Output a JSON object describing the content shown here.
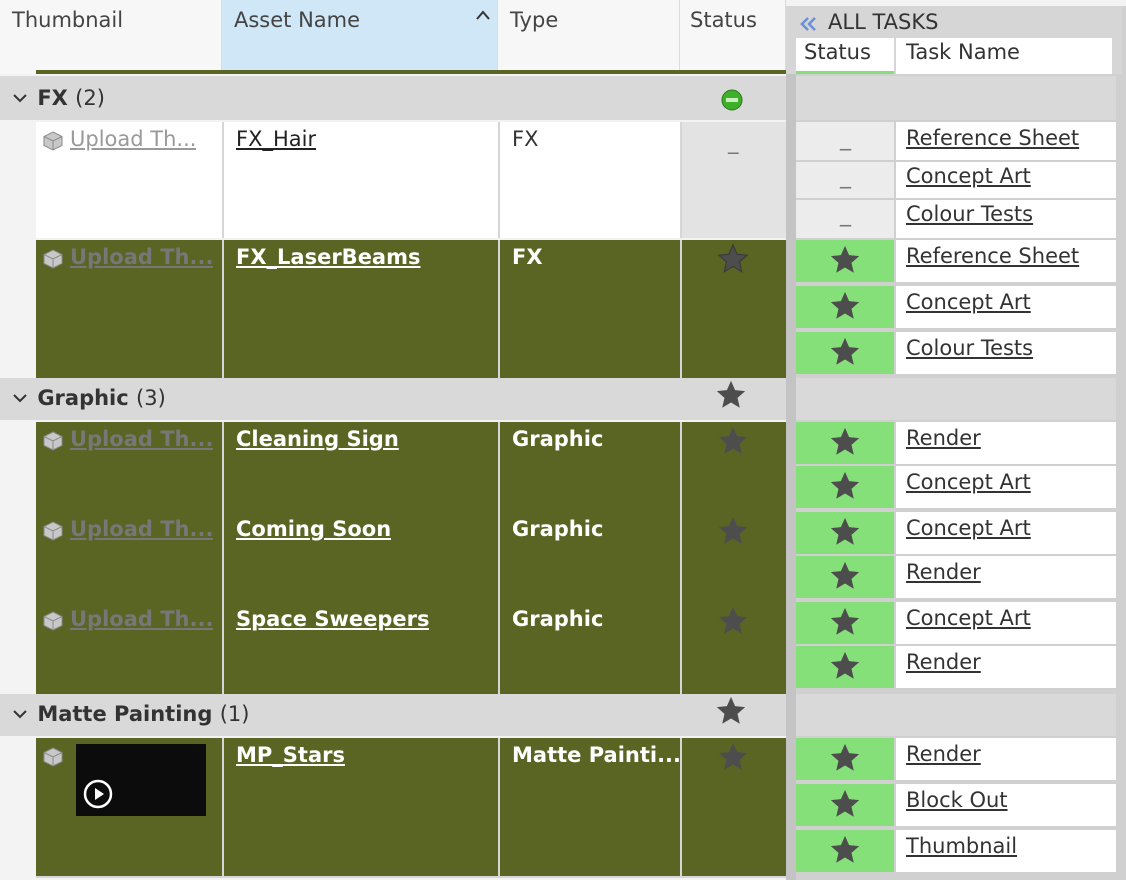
{
  "header": {
    "thumbnail": "Thumbnail",
    "asset_name": "Asset Name",
    "sort_arrow": "^",
    "type": "Type",
    "status": "Status",
    "all_tasks": "ALL TASKS",
    "collapse_icon": "double-chevron-left-icon",
    "task_status": "Status",
    "task_name": "Task Name"
  },
  "groups": [
    {
      "name": "FX",
      "count": "(2)",
      "status": "in-progress-dot"
    },
    {
      "name": "Graphic",
      "count": "(3)",
      "status": "star"
    },
    {
      "name": "Matte Painting",
      "count": "(1)",
      "status": "star"
    }
  ],
  "assets": [
    {
      "thumbnail": "Upload Th...",
      "name": "FX_Hair",
      "type": "FX",
      "status": "_",
      "tasks": [
        {
          "status": "_",
          "name": "Reference Sheet"
        },
        {
          "status": "_",
          "name": "Concept Art"
        },
        {
          "status": "_",
          "name": "Colour Tests"
        }
      ]
    },
    {
      "thumbnail": "Upload Th...",
      "name": "FX_LaserBeams",
      "type": "FX",
      "status": "star",
      "tasks": [
        {
          "status": "star",
          "name": "Reference Sheet"
        },
        {
          "status": "star",
          "name": "Concept Art"
        },
        {
          "status": "star",
          "name": "Colour Tests"
        }
      ]
    },
    {
      "thumbnail": "Upload Th...",
      "name": "Cleaning Sign",
      "type": "Graphic",
      "status": "star",
      "tasks": [
        {
          "status": "star",
          "name": "Render"
        },
        {
          "status": "star",
          "name": "Concept Art"
        }
      ]
    },
    {
      "thumbnail": "Upload Th...",
      "name": "Coming Soon",
      "type": "Graphic",
      "status": "star",
      "tasks": [
        {
          "status": "star",
          "name": "Concept Art"
        },
        {
          "status": "star",
          "name": "Render"
        }
      ]
    },
    {
      "thumbnail": "Upload Th...",
      "name": "Space Sweepers",
      "type": "Graphic",
      "status": "star",
      "tasks": [
        {
          "status": "star",
          "name": "Concept Art"
        },
        {
          "status": "star",
          "name": "Render"
        }
      ]
    },
    {
      "thumbnail": "",
      "name": "MP_Stars",
      "type": "Matte Painti...",
      "status": "star",
      "tasks": [
        {
          "status": "star",
          "name": "Render"
        },
        {
          "status": "star",
          "name": "Block Out"
        },
        {
          "status": "star",
          "name": "Thumbnail"
        }
      ]
    }
  ],
  "colors": {
    "selected_row": "#5a6423",
    "task_done": "#86e07a",
    "sorted_header": "#cfe7f7"
  }
}
